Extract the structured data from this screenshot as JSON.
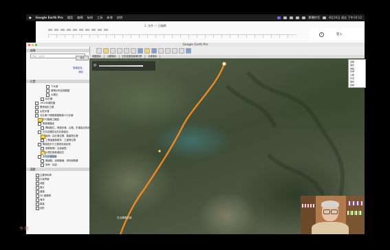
{
  "menubar": {
    "app_name": "Google Earth Pro",
    "items": [
      "檔案",
      "編輯",
      "檢視",
      "工具",
      "新增",
      "說明"
    ],
    "status_text": "繁體拼音",
    "datetime": "8月16日 週五 下午10:12"
  },
  "doc": {
    "title": "2. 文件 — 已編輯",
    "login_label": "登入",
    "help_label": "?"
  },
  "earth": {
    "window_title": "Google Earth Pro",
    "search_button": "搜尋",
    "tabs": [
      "地圖搜尋",
      "山路搜尋",
      "石灰岩層及礦場分佈",
      "大量搜尋"
    ]
  },
  "sidebar": {
    "search_header": "搜尋",
    "search_hint": "例如：台北市",
    "history_link": "搜尋記錄",
    "clear_link": "清除",
    "places_header": "位置",
    "layers_header": "圖層",
    "place_rows": [
      "下水湖",
      "礦場分布及其範圍",
      "大理石",
      "採石場",
      "1902年礦區圖",
      "實測地形之範",
      "山區步道",
      "北五堵73號舊廠建築與人行步道",
      "步行路線之範圍",
      "舊礦場路段",
      "開始點位，經過步道，山路，步道由此到此",
      "石灰岩礦區及石灰窯遺址",
      "說明：採石場位置，舊建物位置",
      "工業遺產與舊有，之建物位置",
      "舊礦區步行之路徑探索紀錄",
      "參觀時間：沿途景點",
      "大理石與各種岩石",
      "人行步道路線",
      "路線點，說明路線，資料與概要",
      "參考：採訪"
    ],
    "layer_rows": [
      "主要資料庫",
      "行政界線",
      "地點",
      "照片",
      "道路",
      "3D 建築物",
      "海洋",
      "氣象",
      "地形"
    ]
  },
  "map": {
    "scale_label": "石山路與石碇",
    "legend_items": [
      "道路",
      "邊界",
      "地點",
      "水域",
      "山脈",
      "步道",
      "礦場",
      "建物"
    ]
  },
  "watermark": "今 閱"
}
